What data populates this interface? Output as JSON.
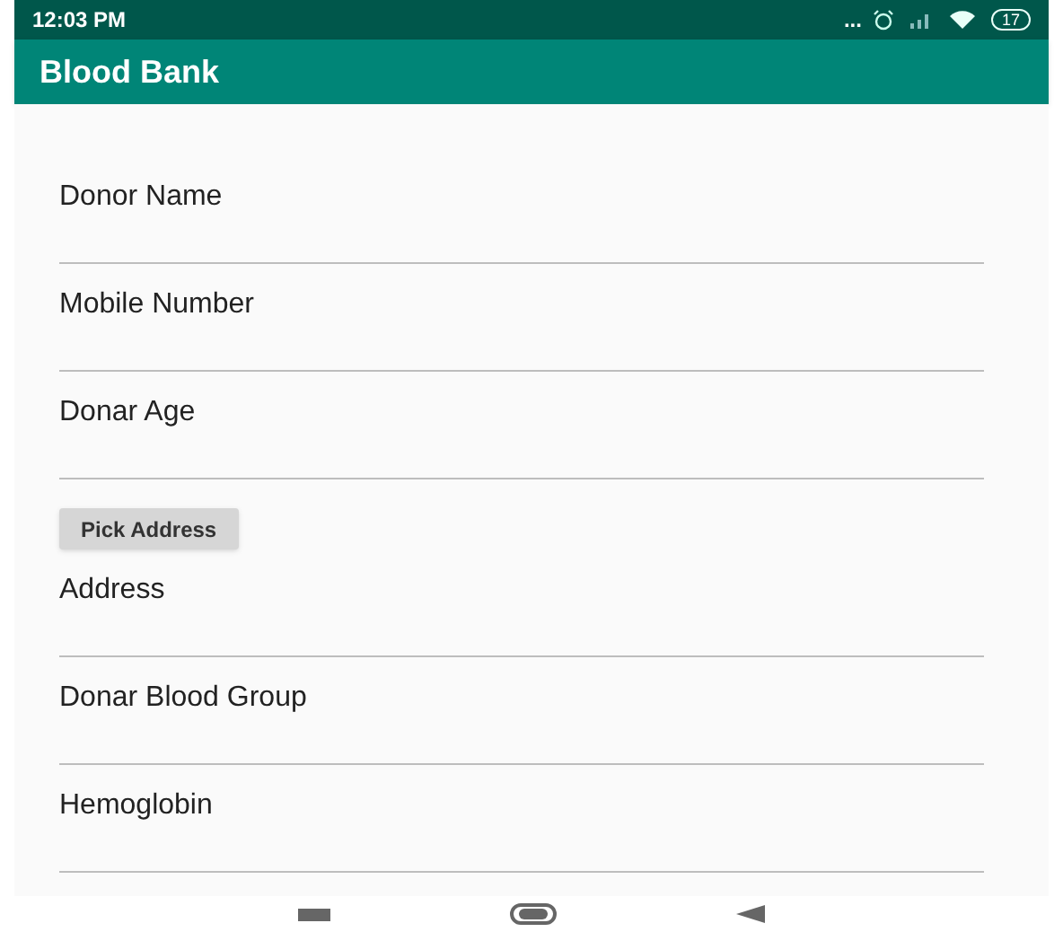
{
  "status_bar": {
    "time": "12:03 PM",
    "more": "...",
    "battery": "17"
  },
  "app_bar": {
    "title": "Blood Bank"
  },
  "fields": [
    {
      "kind": "field",
      "placeholder": "Donor Name"
    },
    {
      "kind": "field",
      "placeholder": "Mobile Number"
    },
    {
      "kind": "field",
      "placeholder": "Donar Age"
    },
    {
      "kind": "button",
      "label": "Pick Address"
    },
    {
      "kind": "field",
      "placeholder": "Address"
    },
    {
      "kind": "field",
      "placeholder": "Donar Blood Group"
    },
    {
      "kind": "field",
      "placeholder": "Hemoglobin"
    }
  ]
}
